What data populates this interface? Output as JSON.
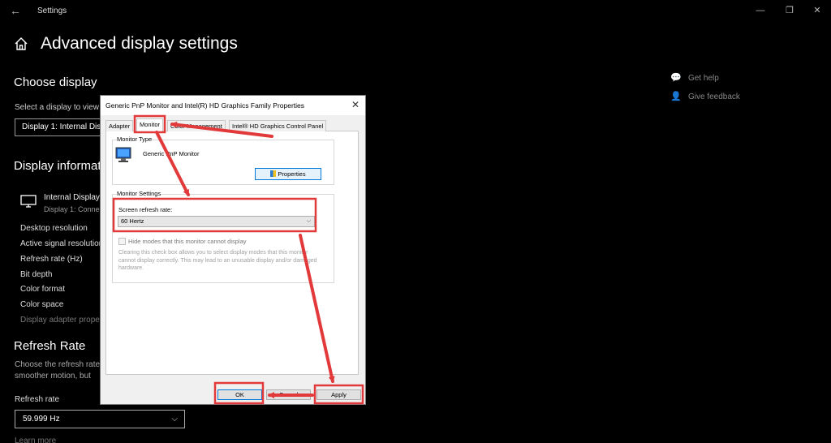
{
  "window": {
    "back_icon": "back-arrow-icon",
    "title": "Settings",
    "minimize": "—",
    "maximize": "❐",
    "close": "✕"
  },
  "page": {
    "home_icon": "home-icon",
    "title": "Advanced display settings"
  },
  "choose_display": {
    "heading": "Choose display",
    "select_label": "Select a display to view",
    "selected_value": "Display 1: Internal Display"
  },
  "display_info": {
    "heading": "Display information",
    "monitor_name": "Internal Display",
    "monitor_sub": "Display 1: Connected to",
    "rows": [
      "Desktop resolution",
      "Active signal resolution",
      "Refresh rate (Hz)",
      "Bit depth",
      "Color format",
      "Color space",
      "Display adapter properties"
    ]
  },
  "refresh_rate": {
    "heading": "Refresh Rate",
    "desc_line1": "Choose the refresh rate",
    "desc_line2": "smoother motion, but",
    "field_label": "Refresh rate",
    "selected_value": "59.999 Hz",
    "learn_more": "Learn more"
  },
  "help": {
    "get_help": "Get help",
    "give_feedback": "Give feedback"
  },
  "dialog": {
    "title": "Generic PnP Monitor and Intel(R) HD Graphics Family Properties",
    "close": "✕",
    "tabs": [
      "Adapter",
      "Monitor",
      "Color Management",
      "Intel® HD Graphics Control Panel"
    ],
    "active_tab": "Monitor",
    "monitor_type": {
      "label": "Monitor Type",
      "name": "Generic PnP Monitor",
      "properties_button": "Properties"
    },
    "monitor_settings": {
      "label": "Monitor Settings",
      "rate_label": "Screen refresh rate:",
      "rate_value": "60 Hertz",
      "hide_modes_label": "Hide modes that this monitor cannot display",
      "hide_modes_checked": false,
      "note": "Clearing this check box allows you to select display modes that this monitor cannot display correctly. This may lead to an unusable display and/or damaged hardware."
    },
    "buttons": {
      "ok": "OK",
      "cancel": "Cancel",
      "apply": "Apply"
    }
  },
  "colors": {
    "background": "#000000",
    "dialog_bg": "#f0f0f0",
    "annotation_red": "#e23a3a",
    "accent_blue": "#0078d7"
  }
}
